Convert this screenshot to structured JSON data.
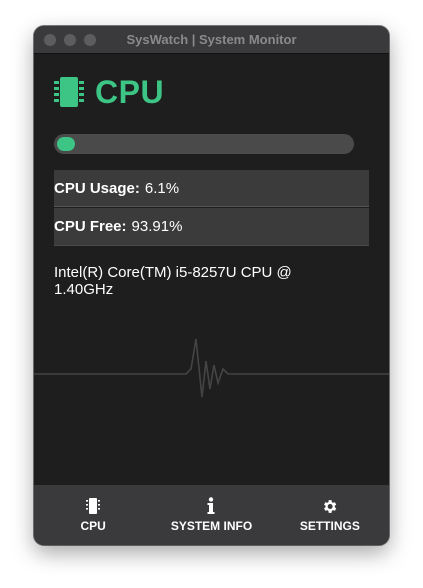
{
  "window": {
    "title": "SysWatch | System Monitor"
  },
  "header": {
    "title": "CPU",
    "icon": "chip-icon"
  },
  "progress": {
    "percent": 6.1
  },
  "stats": {
    "usage_label": "CPU Usage:",
    "usage_value": "6.1%",
    "free_label": "CPU Free:",
    "free_value": "93.91%"
  },
  "cpu_model": "Intel(R) Core(TM) i5-8257U CPU @ 1.40GHz",
  "tabs": [
    {
      "label": "CPU",
      "icon": "chip-icon"
    },
    {
      "label": "SYSTEM INFO",
      "icon": "info-icon"
    },
    {
      "label": "SETTINGS",
      "icon": "gear-icon"
    }
  ],
  "colors": {
    "accent": "#3cc585",
    "background": "#1e1e1e",
    "panel": "#3b3b3b",
    "tabbar": "#3a3a3c"
  }
}
